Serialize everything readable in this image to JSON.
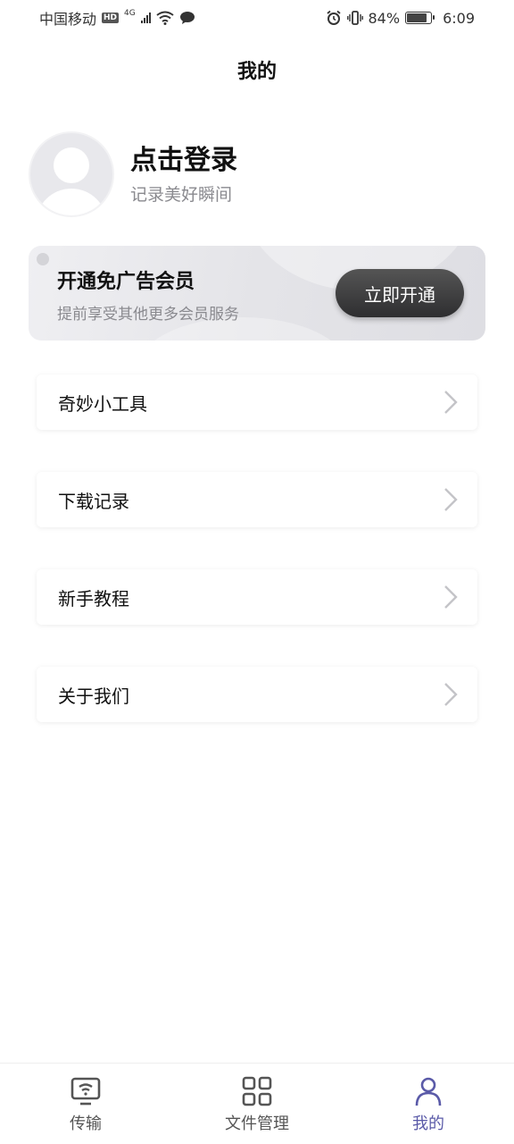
{
  "status_bar": {
    "carrier": "中国移动",
    "hd": "HD",
    "network": "4G",
    "battery": "84%",
    "time": "6:09"
  },
  "page_title": "我的",
  "profile": {
    "login_title": "点击登录",
    "login_subtitle": "记录美好瞬间"
  },
  "vip": {
    "title": "开通免广告会员",
    "subtitle": "提前享受其他更多会员服务",
    "button": "立即开通"
  },
  "menu": [
    {
      "label": "奇妙小工具"
    },
    {
      "label": "下载记录"
    },
    {
      "label": "新手教程"
    },
    {
      "label": "关于我们"
    }
  ],
  "bottom_nav": [
    {
      "label": "传输",
      "icon": "transfer-icon"
    },
    {
      "label": "文件管理",
      "icon": "grid-icon"
    },
    {
      "label": "我的",
      "icon": "user-icon",
      "active": true
    }
  ],
  "colors": {
    "accent": "#5a5aa8",
    "vip_button": "#3a3a3c"
  }
}
